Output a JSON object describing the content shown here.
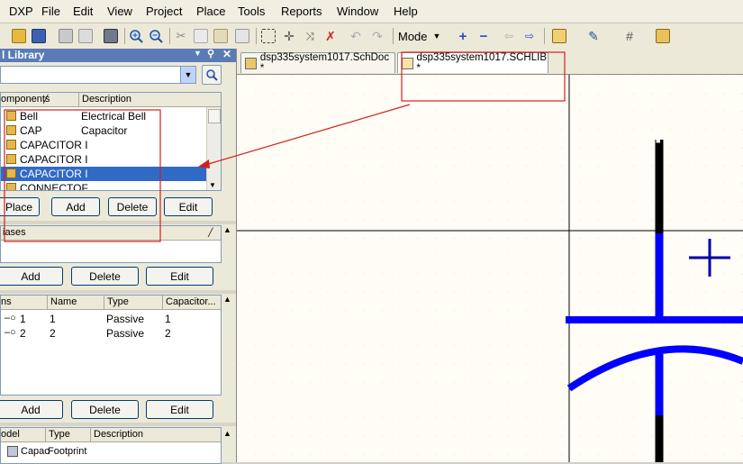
{
  "menu": [
    "DXP",
    "File",
    "Edit",
    "View",
    "Project",
    "Place",
    "Tools",
    "Reports",
    "Window",
    "Help"
  ],
  "toolbar": {
    "mode_label": "Mode",
    "icons": [
      "open-icon",
      "save-icon",
      "print-icon",
      "print-preview-icon",
      "component-icon",
      "zoom-in-icon",
      "zoom-out-icon",
      "cut-icon",
      "copy-icon",
      "paste-icon",
      "paste-array-icon",
      "select-rect-icon",
      "move-icon",
      "cross-select-icon",
      "clear-select-icon",
      "undo-icon",
      "redo-icon",
      "add-icon",
      "remove-icon",
      "back-icon",
      "forward-icon",
      "place-part-icon",
      "drawing-tools-icon",
      "grid-icon",
      "library-icon"
    ]
  },
  "panel": {
    "title": "l Library",
    "components_header": {
      "col1": "omponents",
      "col2": "Description"
    },
    "components": [
      {
        "name": "Bell",
        "desc": "Electrical Bell"
      },
      {
        "name": "CAP",
        "desc": "Capacitor"
      },
      {
        "name": "CAPACITOR I",
        "desc": ""
      },
      {
        "name": "CAPACITOR I",
        "desc": ""
      },
      {
        "name": "CAPACITOR I",
        "desc": ""
      },
      {
        "name": "CONNECTOF",
        "desc": ""
      }
    ],
    "buttons1": {
      "place": "Place",
      "add": "Add",
      "delete": "Delete",
      "edit": "Edit"
    },
    "aliases_header": "iases",
    "buttons2": {
      "add": "Add",
      "delete": "Delete",
      "edit": "Edit"
    },
    "pins_header": {
      "c1": "ns",
      "c2": "Name",
      "c3": "Type",
      "c4": "Capacitor..."
    },
    "pins": [
      {
        "num": "1",
        "name": "1",
        "type": "Passive",
        "cap": "1"
      },
      {
        "num": "2",
        "name": "2",
        "type": "Passive",
        "cap": "2"
      }
    ],
    "buttons3": {
      "add": "Add",
      "delete": "Delete",
      "edit": "Edit"
    },
    "models_header": {
      "c1": "odel",
      "c2": "Type",
      "c3": "Description"
    },
    "models": [
      {
        "name": "Capac",
        "type": "Footprint"
      }
    ]
  },
  "tabs": [
    {
      "label": "dsp335system1017.SchDoc *"
    },
    {
      "label": "dsp335system1017.SCHLIB *"
    }
  ],
  "colors": {
    "selection": "#316ac5",
    "pin": "#0000ff",
    "annotation": "#d02020",
    "panel_header": "#5a7bb5"
  }
}
